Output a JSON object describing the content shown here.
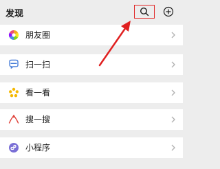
{
  "header": {
    "title": "发现"
  },
  "items": [
    {
      "label": "朋友圈",
      "icon": "moments-icon"
    },
    {
      "label": "扫一扫",
      "icon": "scan-icon"
    },
    {
      "label": "看一看",
      "icon": "top-stories-icon"
    },
    {
      "label": "搜一搜",
      "icon": "search-feature-icon"
    },
    {
      "label": "小程序",
      "icon": "mini-programs-icon"
    }
  ],
  "colors": {
    "highlight_box": "#e02020",
    "arrow": "#e02020",
    "background": "#ededed",
    "row": "#ffffff"
  }
}
